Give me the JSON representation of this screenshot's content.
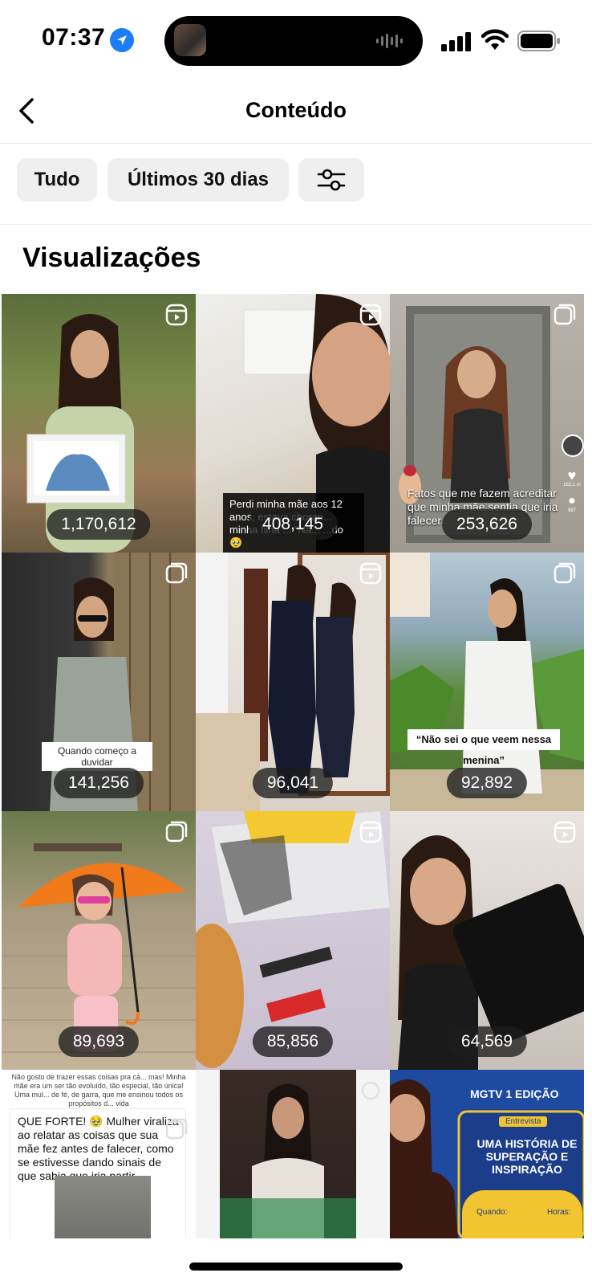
{
  "status_bar": {
    "time": "07:37"
  },
  "header": {
    "title": "Conteúdo"
  },
  "filters": {
    "all": "Tudo",
    "period": "Últimos 30 dias"
  },
  "section": {
    "title": "Visualizações"
  },
  "tiles": [
    {
      "views": "1,170,612",
      "kind": "reel"
    },
    {
      "views": "408,145",
      "kind": "reel",
      "caption": "Perdi minha mãe aos 12 anos, estava choran... minha filha ... \"Nã... ...do 🥹"
    },
    {
      "views": "253,626",
      "kind": "post",
      "caption": "Fatos que me fazem acreditar que minha mãe sentia que iria falecer...",
      "side_likes": "162,1 m",
      "side_comments": "967"
    },
    {
      "views": "141,256",
      "kind": "post",
      "caption": "Quando começo a duvidar"
    },
    {
      "views": "96,041",
      "kind": "reel"
    },
    {
      "views": "92,892",
      "kind": "post",
      "caption": "“Não sei o que veem nessa menina”"
    },
    {
      "views": "89,693",
      "kind": "post"
    },
    {
      "views": "85,856",
      "kind": "reel"
    },
    {
      "views": "64,569",
      "kind": "reel"
    },
    {
      "kind": "post",
      "header_text": "Não gosto de trazer essas coisas pra cá... mas! Minha mãe era um ser tão evoluído, tão especial, tão única! Uma mul... de fé, de garra, que me ensinou todos os propósitos d... vida",
      "caption": "QUE FORTE! 🥹 Mulher viraliza ao relatar as coisas que sua mãe fez antes de falecer, como se estivesse dando sinais de que sabia que iria partir"
    },
    {
      "kind": "loading"
    },
    {
      "kind": "post",
      "banner_title": "MGTV 1 EDIÇÃO",
      "banner_tag": "Entrevista",
      "banner_headline": "UMA HISTÓRIA DE SUPERAÇÃO E INSPIRAÇÃO",
      "banner_when": "Quando:",
      "banner_hours": "Horas:"
    }
  ]
}
